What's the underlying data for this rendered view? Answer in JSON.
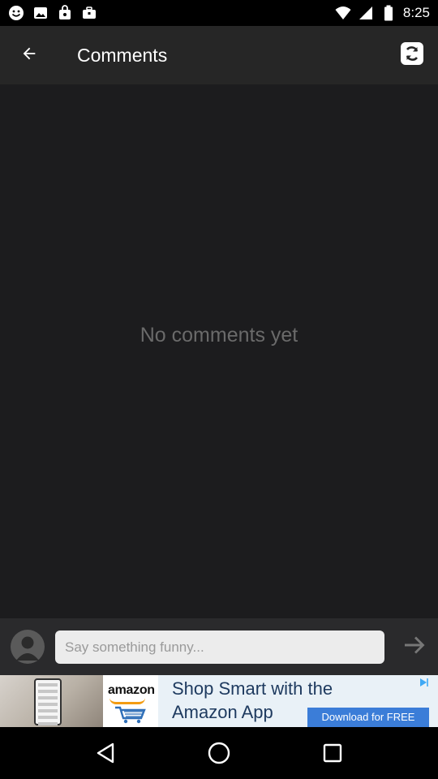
{
  "status_bar": {
    "time": "8:25",
    "left_icons": [
      "emoji-icon",
      "image-icon",
      "bag-icon",
      "briefcase-icon"
    ],
    "right_icons": [
      "wifi-icon",
      "signal-icon",
      "battery-icon"
    ]
  },
  "app_bar": {
    "title": "Comments",
    "back_icon": "arrow-left-icon",
    "refresh_icon": "refresh-icon"
  },
  "content": {
    "empty_message": "No comments yet"
  },
  "comment_bar": {
    "placeholder": "Say something funny...",
    "value": "",
    "send_icon": "arrow-right-icon"
  },
  "ad": {
    "brand": "amazon",
    "headline_line1": "Shop Smart with the",
    "headline_line2": "Amazon App",
    "cta": "Download for FREE",
    "colors": {
      "cta": "#3b7dd8",
      "headline": "#1e3a5f"
    }
  },
  "nav_bar": {
    "buttons": [
      "back-triangle-icon",
      "home-circle-icon",
      "recents-square-icon"
    ]
  },
  "colors": {
    "app_bar": "#262626",
    "content_bg": "#1c1c1e",
    "empty_text": "#6a6a6a",
    "comment_bar": "#2a2a2c"
  }
}
